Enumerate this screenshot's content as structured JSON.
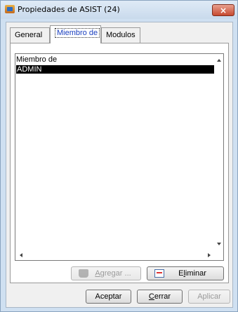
{
  "window": {
    "title": "Propiedades de ASIST (24)",
    "close_glyph": "×"
  },
  "tabs": [
    {
      "label": "General",
      "active": false
    },
    {
      "label": "Miembro de",
      "active": true
    },
    {
      "label": "Modulos",
      "active": false
    }
  ],
  "member_list": {
    "header": "Miembro de",
    "rows": [
      "ADMIN"
    ],
    "selected_row": "ADMIN"
  },
  "panel_buttons": {
    "add": {
      "pre": "",
      "mnemonic": "A",
      "post": "gregar ...",
      "enabled": false,
      "icon": "hand-icon"
    },
    "remove": {
      "pre": "E",
      "mnemonic": "l",
      "post": "iminar",
      "enabled": true,
      "icon": "delete-icon"
    }
  },
  "dialog_buttons": {
    "ok": {
      "label": "Aceptar"
    },
    "close": {
      "mnemonic": "C",
      "post": "errar"
    },
    "apply": {
      "label": "Aplicar",
      "enabled": false
    }
  },
  "colors": {
    "selection_bg": "#000000",
    "selection_fg": "#ffffff",
    "close_button": "#c74a30"
  }
}
